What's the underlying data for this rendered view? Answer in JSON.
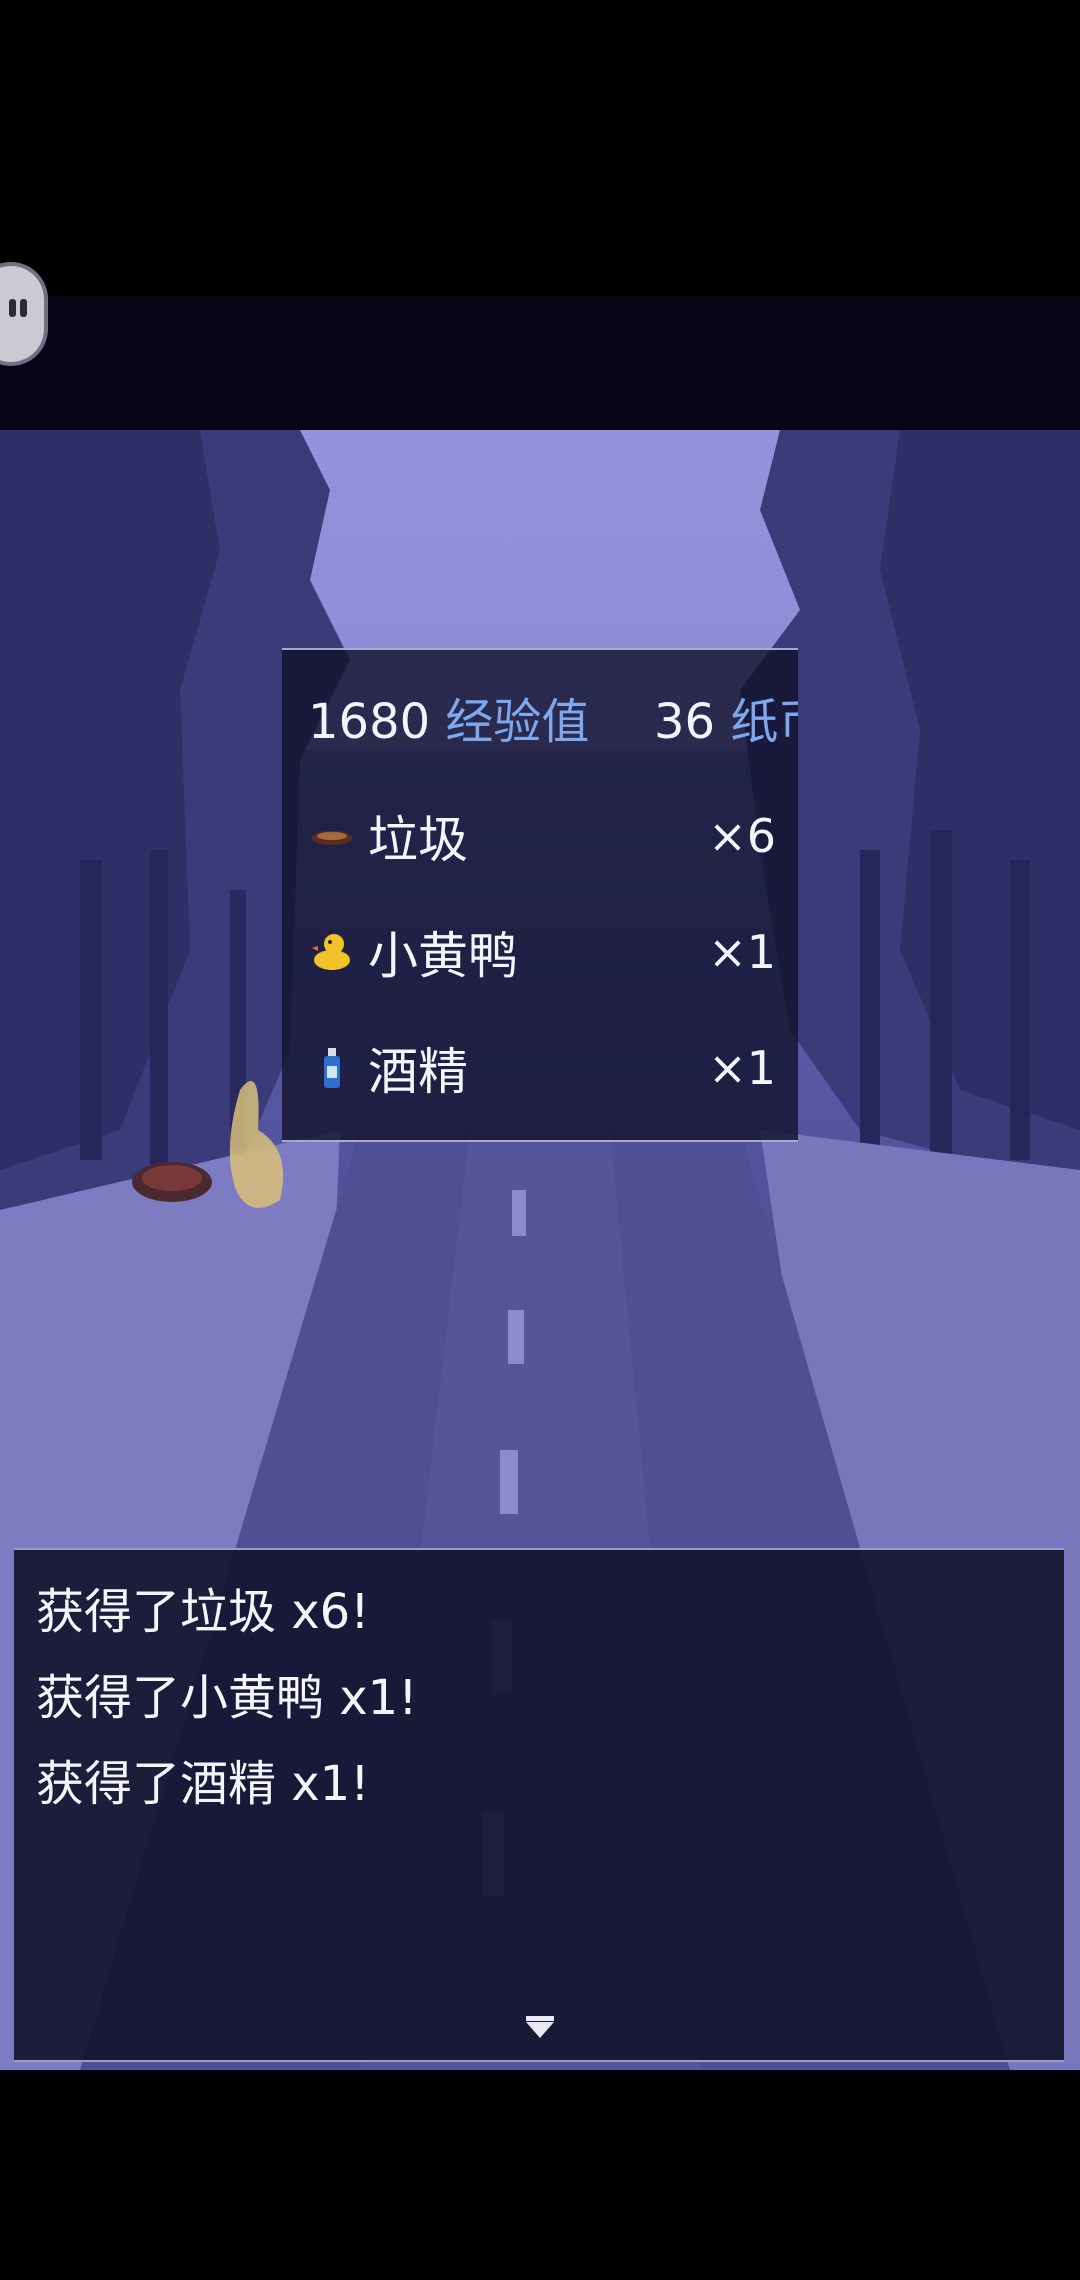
{
  "reward": {
    "exp_value": "1680",
    "exp_unit": "经验值",
    "money_value": "36",
    "money_unit": "纸币",
    "items": [
      {
        "icon": "trash-icon",
        "name": "垃圾",
        "qty": "×6"
      },
      {
        "icon": "rubber-duck-icon",
        "name": "小黄鸭",
        "qty": "×1"
      },
      {
        "icon": "alcohol-bottle-icon",
        "name": "酒精",
        "qty": "×1"
      }
    ]
  },
  "messages": [
    "获得了垃圾 x6!",
    "获得了小黄鸭 x1!",
    "获得了酒精 x1!"
  ],
  "colors": {
    "highlight_text": "#7fa7ee",
    "window_bg": "#10122c",
    "scene_sky": "#8b88d6",
    "scene_trees": "#3a3a78"
  }
}
